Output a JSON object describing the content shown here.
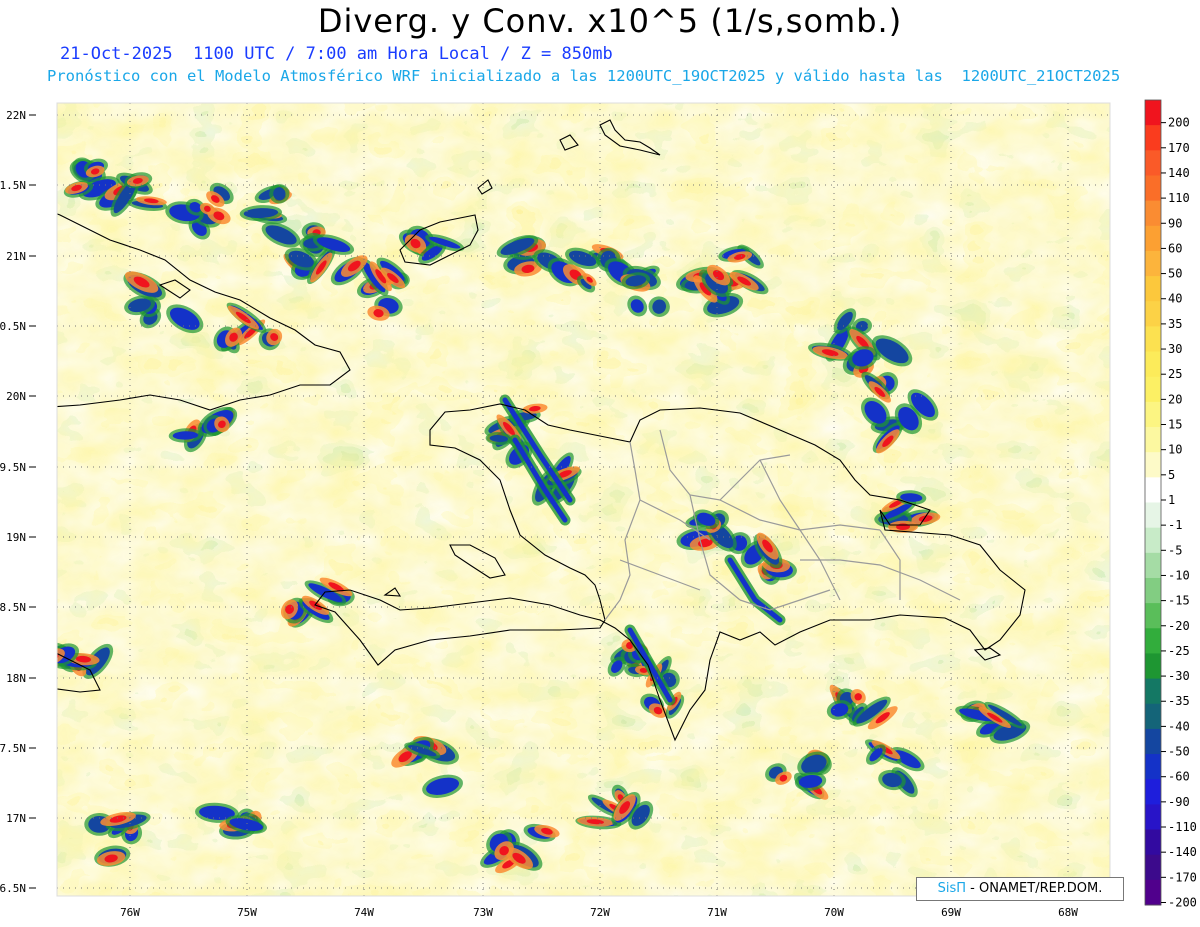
{
  "title": "Diverg. y Conv. x10^5 (1/s,somb.)",
  "subtitle_line1": "21-Oct-2025  1100 UTC / 7:00 am Hora Local / Z = 850mb",
  "subtitle_line2": "Pronóstico con el Modelo Atmosférico WRF inicializado a las 1200UTC_19OCT2025 y válido hasta las  1200UTC_21OCT2025",
  "credit": {
    "brand": "SisΠ",
    "text": " - ONAMET/REP.DOM."
  },
  "lat_labels": [
    "22N",
    "1.5N",
    "21N",
    "0.5N",
    "20N",
    "9.5N",
    "19N",
    "8.5N",
    "18N",
    "7.5N",
    "17N",
    "6.5N"
  ],
  "lon_labels": [
    "76W",
    "75W",
    "74W",
    "73W",
    "72W",
    "71W",
    "70W",
    "69W",
    "68W"
  ],
  "colorbar": {
    "labels": [
      "200",
      "170",
      "140",
      "110",
      "90",
      "60",
      "50",
      "40",
      "35",
      "30",
      "25",
      "20",
      "15",
      "10",
      "5",
      "1",
      "-1",
      "-5",
      "-10",
      "-15",
      "-20",
      "-25",
      "-30",
      "-35",
      "-40",
      "-50",
      "-60",
      "-90",
      "-110",
      "-140",
      "-170",
      "-200"
    ],
    "colors": [
      "#f0141e",
      "#fa3c1e",
      "#fa5a28",
      "#fa6e28",
      "#fa8c32",
      "#fca032",
      "#fcb43c",
      "#fcc83c",
      "#fcd246",
      "#fce150",
      "#fceb5a",
      "#fcf064",
      "#fcf582",
      "#fcf8a0",
      "#fdfac8",
      "#ffffff",
      "#e6f5e6",
      "#c8ebc8",
      "#a5dca5",
      "#82cd82",
      "#5abe5a",
      "#32ad3c",
      "#1e9632",
      "#147864",
      "#146478",
      "#1446a0",
      "#1432c8",
      "#1e1edc",
      "#2814c8",
      "#320aa0",
      "#3c0a8c",
      "#50008c"
    ]
  },
  "domain": {
    "lon_min": -76.6,
    "lon_max": -67.6,
    "lat_min": 16.45,
    "lat_max": 22.05
  }
}
